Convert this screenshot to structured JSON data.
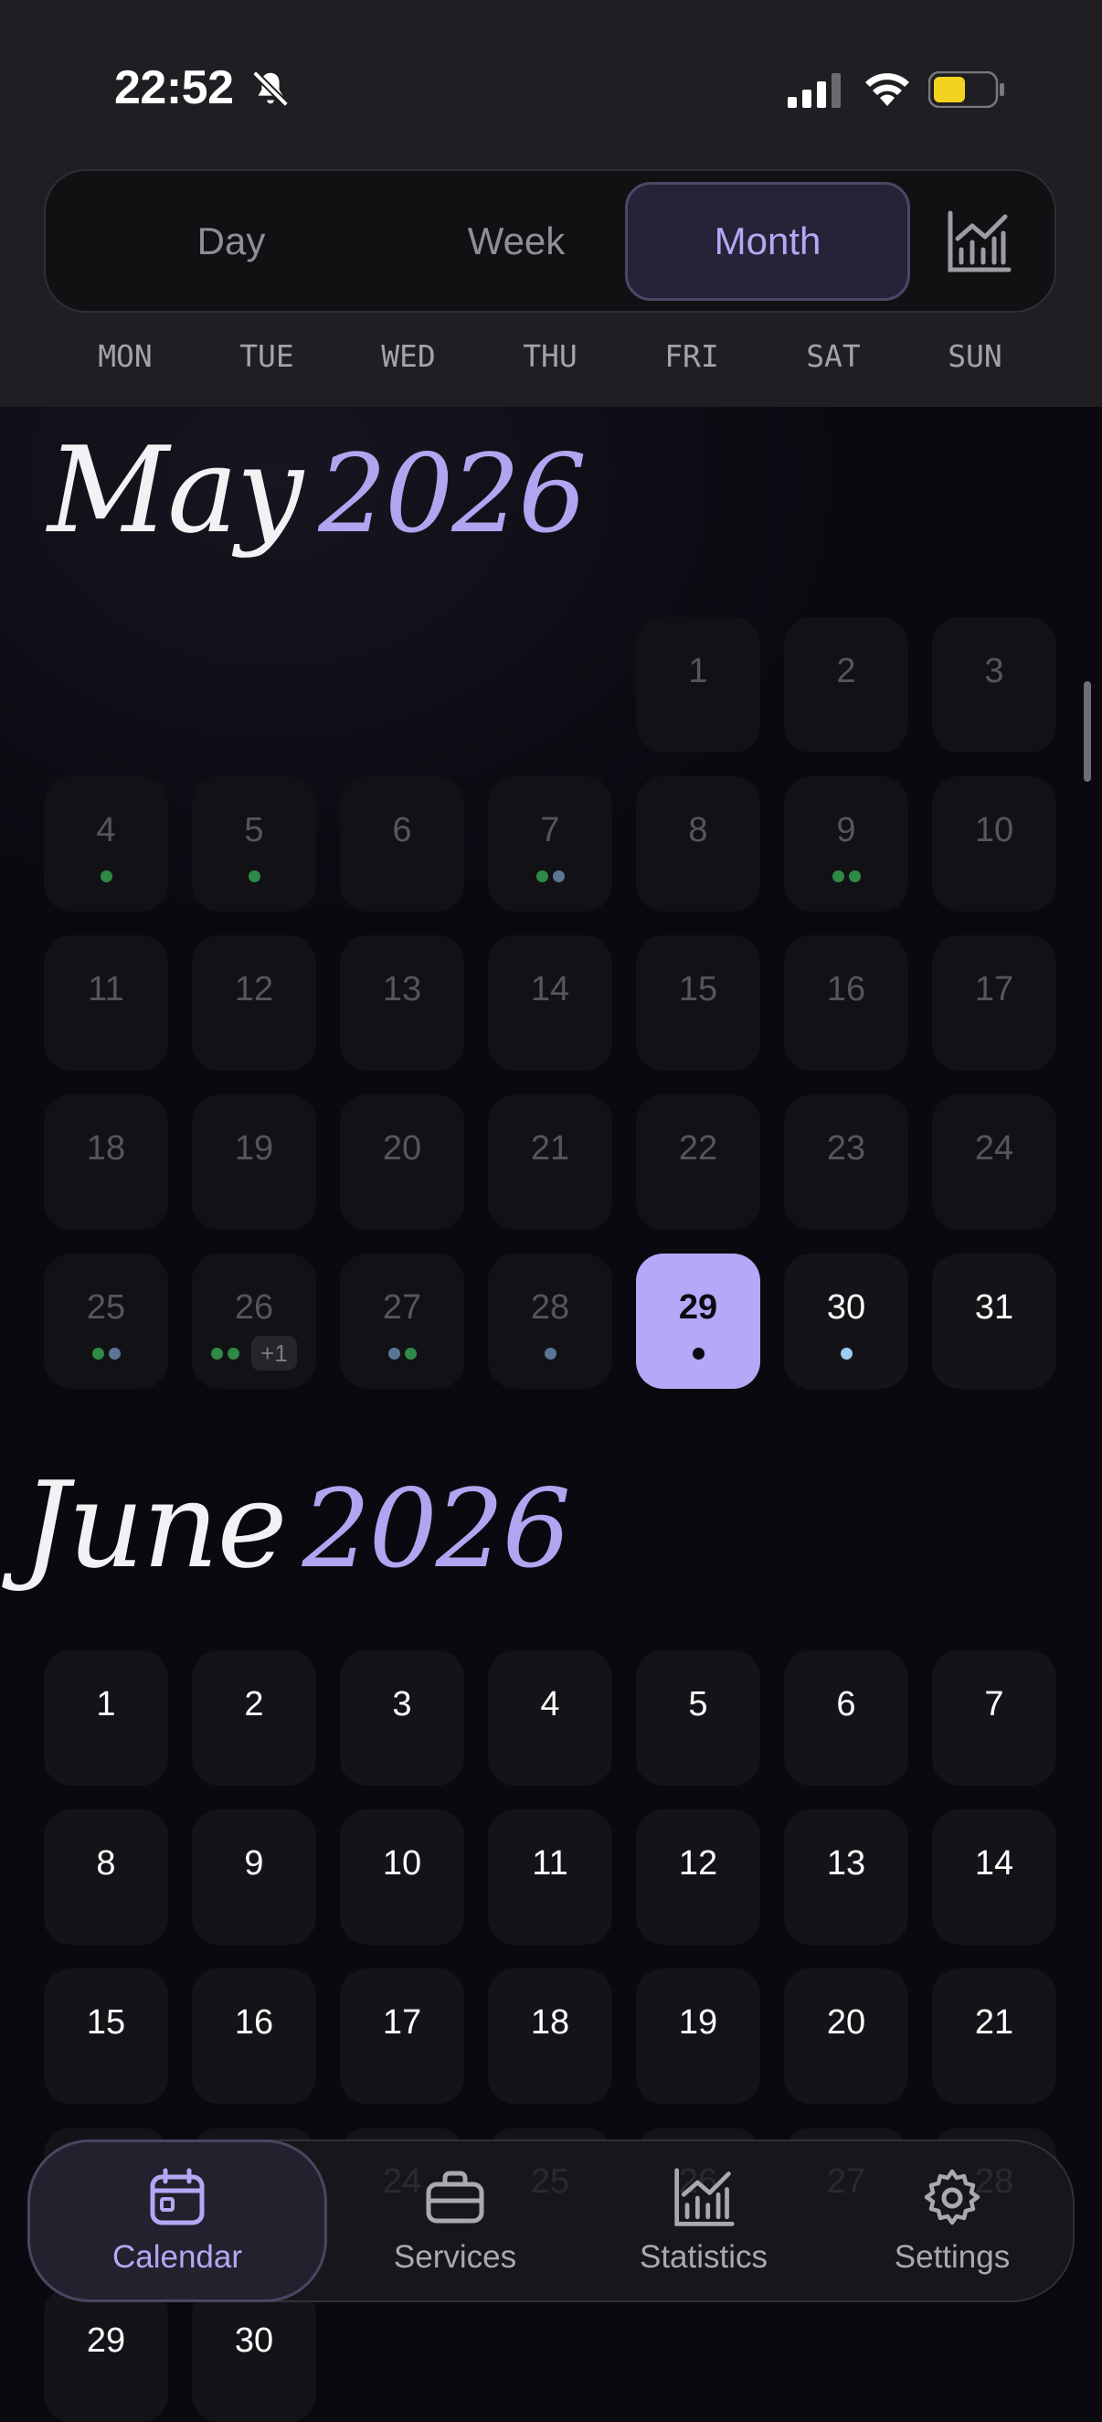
{
  "status_bar": {
    "time": "22:52"
  },
  "view_switcher": {
    "tabs": [
      "Day",
      "Week",
      "Month"
    ],
    "selected": "Month",
    "chart_icon": "chart-icon"
  },
  "weekdays": [
    "MON",
    "TUE",
    "WED",
    "THU",
    "FRI",
    "SAT",
    "SUN"
  ],
  "colors": {
    "accent": "#b5a8f6",
    "dot_green": "#2e8a46",
    "dot_blue": "#5b7596",
    "dot_light_blue": "#9ecbef",
    "dot_dark": "#0b0a12"
  },
  "months": [
    {
      "name": "May",
      "year": "2026",
      "days": [
        {
          "n": "1",
          "dots": []
        },
        {
          "n": "2",
          "dots": []
        },
        {
          "n": "3",
          "dots": []
        },
        {
          "n": "4",
          "dots": [
            "green"
          ]
        },
        {
          "n": "5",
          "dots": [
            "green"
          ]
        },
        {
          "n": "6",
          "dots": []
        },
        {
          "n": "7",
          "dots": [
            "green",
            "blue"
          ]
        },
        {
          "n": "8",
          "dots": []
        },
        {
          "n": "9",
          "dots": [
            "green",
            "green"
          ]
        },
        {
          "n": "10",
          "dots": []
        },
        {
          "n": "11",
          "dots": []
        },
        {
          "n": "12",
          "dots": []
        },
        {
          "n": "13",
          "dots": []
        },
        {
          "n": "14",
          "dots": []
        },
        {
          "n": "15",
          "dots": []
        },
        {
          "n": "16",
          "dots": []
        },
        {
          "n": "17",
          "dots": []
        },
        {
          "n": "18",
          "dots": []
        },
        {
          "n": "19",
          "dots": []
        },
        {
          "n": "20",
          "dots": []
        },
        {
          "n": "21",
          "dots": []
        },
        {
          "n": "22",
          "dots": []
        },
        {
          "n": "23",
          "dots": []
        },
        {
          "n": "24",
          "dots": []
        },
        {
          "n": "25",
          "dots": [
            "green",
            "blue"
          ]
        },
        {
          "n": "26",
          "dots": [
            "green",
            "green"
          ],
          "more": "+1"
        },
        {
          "n": "27",
          "dots": [
            "blue",
            "green"
          ]
        },
        {
          "n": "28",
          "dots": [
            "blue"
          ]
        },
        {
          "n": "29",
          "dots": [
            "dark"
          ],
          "today": true
        },
        {
          "n": "30",
          "dots": [
            "light_blue"
          ]
        },
        {
          "n": "31",
          "dots": []
        }
      ]
    },
    {
      "name": "June",
      "year": "2026",
      "days": [
        {
          "n": "1"
        },
        {
          "n": "2"
        },
        {
          "n": "3"
        },
        {
          "n": "4"
        },
        {
          "n": "5"
        },
        {
          "n": "6"
        },
        {
          "n": "7"
        },
        {
          "n": "8"
        },
        {
          "n": "9"
        },
        {
          "n": "10"
        },
        {
          "n": "11"
        },
        {
          "n": "12"
        },
        {
          "n": "13"
        },
        {
          "n": "14"
        },
        {
          "n": "15"
        },
        {
          "n": "16"
        },
        {
          "n": "17"
        },
        {
          "n": "18"
        },
        {
          "n": "19"
        },
        {
          "n": "20"
        },
        {
          "n": "21"
        },
        {
          "n": "22"
        },
        {
          "n": "23"
        },
        {
          "n": "24"
        },
        {
          "n": "25"
        },
        {
          "n": "26"
        },
        {
          "n": "27"
        },
        {
          "n": "28"
        },
        {
          "n": "29"
        },
        {
          "n": "30"
        }
      ]
    }
  ],
  "bottom_nav": [
    {
      "label": "Calendar",
      "icon": "calendar-icon",
      "active": true
    },
    {
      "label": "Services",
      "icon": "briefcase-icon"
    },
    {
      "label": "Statistics",
      "icon": "chart-icon"
    },
    {
      "label": "Settings",
      "icon": "gear-icon"
    }
  ]
}
